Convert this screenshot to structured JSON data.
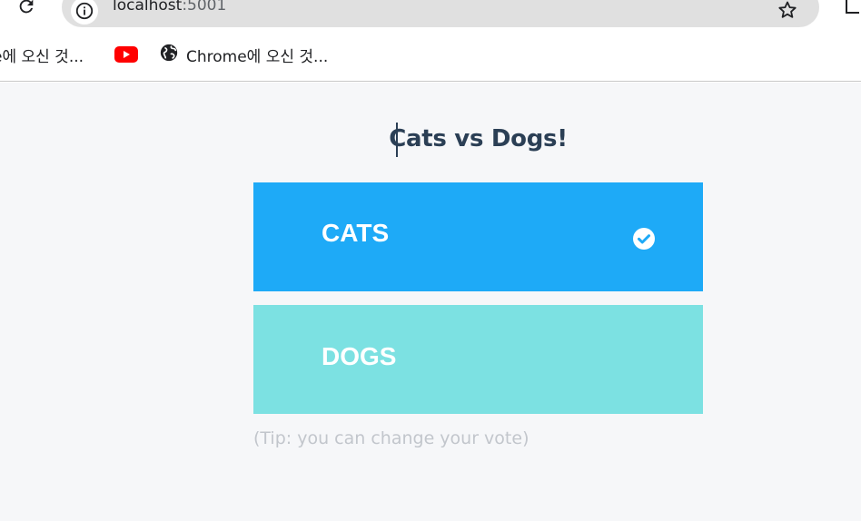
{
  "browser": {
    "url_host": "localhost",
    "url_port": ":5001",
    "bookmarks": [
      {
        "label": "e에 오신 것...",
        "icon": "chrome-icon"
      },
      {
        "label": "",
        "icon": "youtube-icon"
      },
      {
        "label": "Chrome에 오신 것...",
        "icon": "globe-icon"
      }
    ]
  },
  "page": {
    "title": "Cats vs Dogs!",
    "options": [
      {
        "label": "CATS",
        "selected": true,
        "color": "#1eaaf7"
      },
      {
        "label": "DOGS",
        "selected": false,
        "color": "#7ce1e2"
      }
    ],
    "tip": "(Tip: you can change your vote)"
  },
  "colors": {
    "page_background": "#f6f7f9",
    "title": "#2b3f55",
    "tip": "#c2c6cc"
  }
}
